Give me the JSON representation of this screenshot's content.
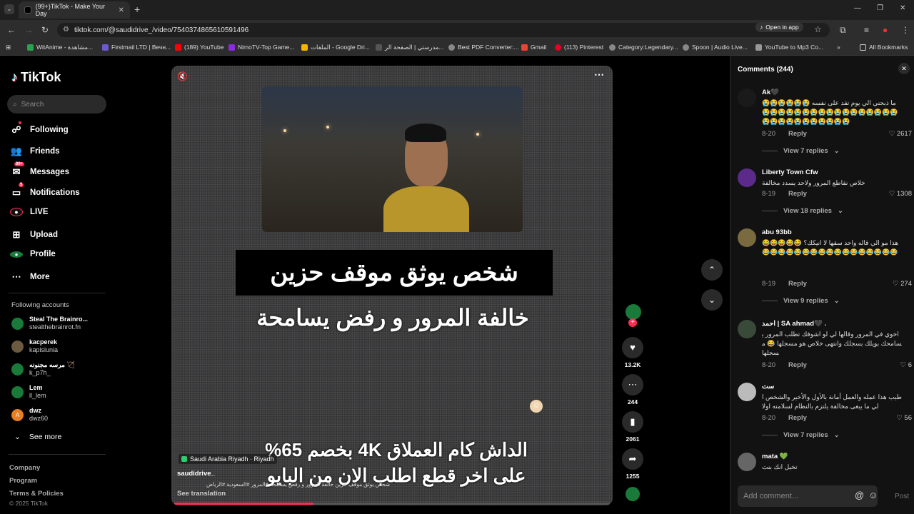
{
  "browser": {
    "tab_title": "(99+)TikTok - Make Your Day",
    "url": "tiktok.com/@saudidrive_/video/7540374865610591496",
    "open_in_app": "Open in app",
    "bookmarks": [
      "WitAnime - مشاهدة...",
      "Firstmail LTD | Вечн...",
      "(189) YouTube",
      "NimoTV-Top Game...",
      "الملفات - Google Dri...",
      "مدرستي | الصفحة الر...",
      "Best PDF Converter:...",
      "Gmail",
      "(113) Pinterest",
      "Category:Legendary...",
      "Spoon | Audio Live...",
      "YouTube to Mp3 Co..."
    ],
    "all_bookmarks": "All Bookmarks"
  },
  "sidebar": {
    "logo": "TikTok",
    "search_placeholder": "Search",
    "nav": [
      {
        "label": "Following",
        "icon": "following-icon"
      },
      {
        "label": "Friends",
        "icon": "friends-icon"
      },
      {
        "label": "Messages",
        "icon": "messages-icon",
        "badge": "99+"
      },
      {
        "label": "Notifications",
        "icon": "notifications-icon",
        "badge": "5"
      },
      {
        "label": "LIVE",
        "icon": "live-icon"
      },
      {
        "label": "Upload",
        "icon": "upload-icon"
      },
      {
        "label": "Profile",
        "icon": "profile-icon"
      },
      {
        "label": "More",
        "icon": "more-icon"
      }
    ],
    "following_title": "Following accounts",
    "accounts": [
      {
        "name": "Steal The Brainro...",
        "user": "stealthebrainrot.fn"
      },
      {
        "name": "kacperek",
        "user": "kapisiunia"
      },
      {
        "name": "مرسه مجنونه 🏹",
        "user": "k_p7h_"
      },
      {
        "name": "Lem",
        "user": "ll_lem"
      },
      {
        "name": "dwz",
        "user": "dwz60",
        "initial": "A"
      }
    ],
    "see_more": "See more",
    "footer": [
      "Company",
      "Program",
      "Terms & Policies"
    ],
    "copyright": "© 2025 TikTok"
  },
  "video": {
    "caption_box": "شخص يوثق موقف حزين",
    "caption_line2": "خالفة المرور و رفض يسامحة",
    "promo_line1": "الداش كام العملاق 4K بخصم 65%",
    "promo_line2": "على اخر قطع اطلب الان من البايو",
    "location": "Saudi Arabia Riyadh · Riyadh",
    "author": "saudidrive_",
    "description": "شخص يوثق موقف حزين خالفة المرور و رفض يسامحة #المرور #السعودية #الرياض",
    "see_translation": "See translation",
    "progress": 0.32
  },
  "actions": {
    "likes": "13.2K",
    "comments": "244",
    "saves": "2061",
    "shares": "1255"
  },
  "comments_panel": {
    "title": "Comments (244)",
    "add_placeholder": "Add comment...",
    "post": "Post",
    "items": [
      {
        "name": "Ak🖤",
        "text": "ما ذبحني الي يوم تقد على نفسه 😭😭😭😭😭😭😭😭😭😭😭😭😭😭😭😭😭😭😭😭😭😭😭😭😭😭😭😭😭😭😭😭😭😭",
        "date": "8-20",
        "reply": "Reply",
        "likes": "2617",
        "replies": "View 7 replies"
      },
      {
        "name": "Liberty Town Cfw",
        "text": "خلاص نقاطع المرور ولاحد يسدد مخالفة",
        "date": "8-19",
        "reply": "Reply",
        "likes": "1308",
        "replies": "View 18 replies"
      },
      {
        "name": "abu 93bb",
        "text": "هذا مو الي قاله واحد سقها لا انيكك؟ 😂😂😂😂😂😂😂😂😂😂😂😂😂😂😂😂😂😂😂😂😂😂",
        "date": "8-19",
        "reply": "Reply",
        "likes": "274",
        "replies": "View 9 replies"
      },
      {
        "name": "احمد | SA ahmad🖤 .",
        "text": "اخوي في المرور وقالها لي لو اشوفك تطلب المرور يسامحك بويلك بسجلك وانتهى خلاص هو مسجلها 😂 مسجلها",
        "date": "8-20",
        "reply": "Reply",
        "likes": "6"
      },
      {
        "name": "ست",
        "text": "طيب هذا عمله والعمل أمانة بالأول والأخير والشخص الي ما يبغى مخالفة يلتزم بالنظام لسلامته اولا",
        "date": "8-20",
        "reply": "Reply",
        "likes": "56",
        "replies": "View 7 replies"
      },
      {
        "name": "mata 💚",
        "text": "تخيل انك بنت"
      }
    ]
  }
}
